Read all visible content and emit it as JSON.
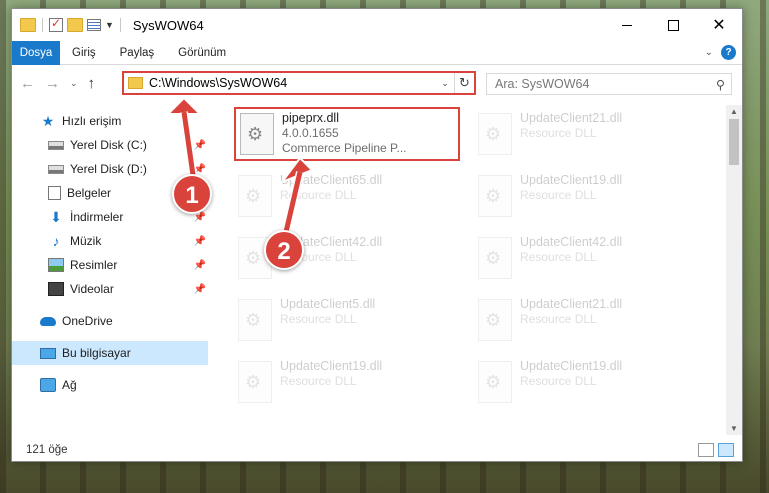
{
  "window": {
    "title": "SysWOW64",
    "controls": {
      "minimize": "",
      "maximize": "",
      "close": "✕"
    }
  },
  "ribbon": {
    "tabs": [
      "Dosya",
      "Giriş",
      "Paylaş",
      "Görünüm"
    ]
  },
  "address": {
    "path": "C:\\Windows\\SysWOW64",
    "search_placeholder": "Ara: SysWOW64"
  },
  "nav_pane": {
    "items": [
      {
        "label": "Hızlı erişim",
        "icon": "star-icon",
        "pinned": false
      },
      {
        "label": "Yerel Disk (C:)",
        "icon": "disk-icon",
        "pinned": true
      },
      {
        "label": "Yerel Disk (D:)",
        "icon": "disk-icon",
        "pinned": true
      },
      {
        "label": "Belgeler",
        "icon": "documents-icon",
        "pinned": true
      },
      {
        "label": "İndirmeler",
        "icon": "download-icon",
        "pinned": true
      },
      {
        "label": "Müzik",
        "icon": "music-icon",
        "pinned": true
      },
      {
        "label": "Resimler",
        "icon": "pictures-icon",
        "pinned": true
      },
      {
        "label": "Videolar",
        "icon": "videos-icon",
        "pinned": true
      },
      {
        "label": "OneDrive",
        "icon": "onedrive-icon",
        "pinned": false
      },
      {
        "label": "Bu bilgisayar",
        "icon": "computer-icon",
        "pinned": false,
        "selected": true
      },
      {
        "label": "Ağ",
        "icon": "network-icon",
        "pinned": false
      }
    ]
  },
  "files": [
    {
      "name": "pipeprx.dll",
      "version": "4.0.0.1655",
      "desc": "Commerce Pipeline P...",
      "highlighted": true
    },
    {
      "name": "UpdateClient21.dll",
      "desc": "Resource DLL"
    },
    {
      "name": "UpdateClient65.dll",
      "desc": "Resource DLL"
    },
    {
      "name": "UpdateClient19.dll",
      "desc": "Resource DLL"
    },
    {
      "name": "UpdateClient42.dll",
      "desc": "Resource DLL"
    },
    {
      "name": "UpdateClient42.dll",
      "desc": "Resource DLL"
    },
    {
      "name": "UpdateClient5.dll",
      "desc": "Resource DLL"
    },
    {
      "name": "UpdateClient21.dll",
      "desc": "Resource DLL"
    },
    {
      "name": "UpdateClient19.dll",
      "desc": "Resource DLL"
    },
    {
      "name": "UpdateClient19.dll",
      "desc": "Resource DLL"
    }
  ],
  "status": {
    "count": "121 öğe"
  },
  "annotations": {
    "step1": "1",
    "step2": "2",
    "color": "#d9433b"
  }
}
